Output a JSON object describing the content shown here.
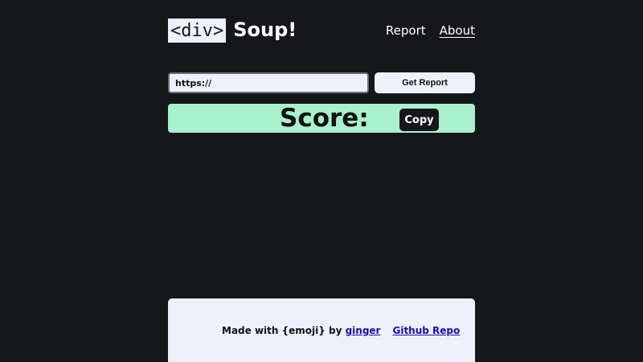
{
  "header": {
    "logo_code": "<div>",
    "logo_text": "Soup!",
    "nav": [
      {
        "label": "Report",
        "active": false
      },
      {
        "label": "About",
        "active": true
      }
    ]
  },
  "form": {
    "url_value": "https://",
    "submit_label": "Get Report"
  },
  "score": {
    "label": "Score:",
    "copy_label": "Copy"
  },
  "footer": {
    "made_with": "Made with {emoji} by",
    "author_link": "ginger",
    "repo_link": "Github Repo"
  },
  "colors": {
    "background": "#16171b",
    "panel": "#eef0fb",
    "score_bar": "#a9f0cc",
    "link": "#1a0dab"
  }
}
